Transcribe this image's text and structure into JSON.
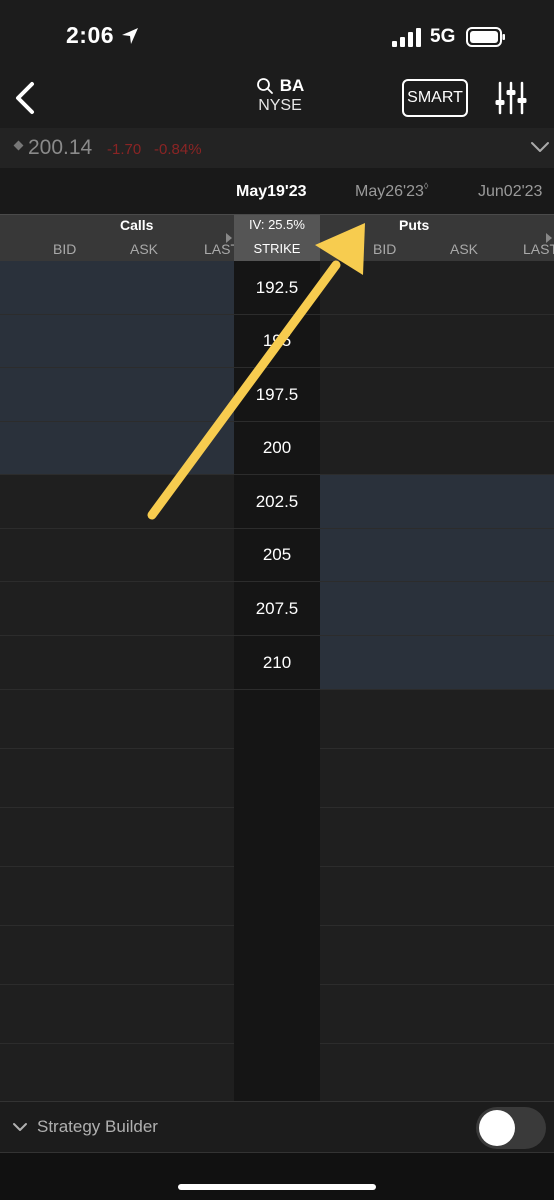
{
  "status_bar": {
    "time": "2:06",
    "network": "5G"
  },
  "nav": {
    "symbol": "BA",
    "exchange": "NYSE",
    "smart_label": "SMART"
  },
  "quote": {
    "last_price": "200.14",
    "change": "-1.70",
    "change_pct": "-0.84%",
    "change_color": "#8a2424"
  },
  "expiries": {
    "active": "May19'23",
    "second": "May26'23",
    "third": "Jun02'23"
  },
  "header": {
    "calls_title": "Calls",
    "puts_title": "Puts",
    "iv": "IV: 25.5%",
    "strike_label": "STRIKE",
    "calls_columns": [
      "BID",
      "ASK",
      "LAST"
    ],
    "puts_columns": [
      "BID",
      "ASK",
      "LAST"
    ]
  },
  "strikes": [
    "192.5",
    "195",
    "197.5",
    "200",
    "202.5",
    "205",
    "207.5",
    "210"
  ],
  "strategy_builder": {
    "label": "Strategy Builder",
    "toggle_on": false
  },
  "colors": {
    "in_the_money": "#2a313b",
    "annotation_arrow": "#f7cc4f"
  }
}
